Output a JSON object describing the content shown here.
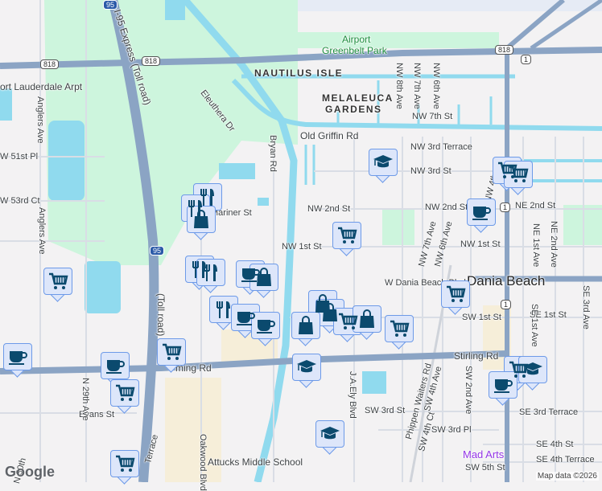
{
  "colors": {
    "land": "#f3f2f3",
    "park": "#cdf5dd",
    "water": "#90daee",
    "road": "#8ba4c4",
    "marker_bg": "#dde6fa",
    "marker_border": "#6d9ae8",
    "icon": "#0b4a6e"
  },
  "shields": {
    "sr818_a": "818",
    "sr818_b": "818",
    "sr818_c": "818",
    "i95_top": "95",
    "i95_mid": "95",
    "us1_a": "1",
    "us1_b": "1",
    "us1_c": "1"
  },
  "labels": [
    "Airport",
    "Greenbelt Park",
    "NAUTILUS ISLE",
    "MELALEUCA",
    "GARDENS",
    "NW 8th Ave",
    "NW 7th Ave",
    "NW 6th Ave",
    "NW 7th St",
    "Old Griffin Rd",
    "NW 3rd Terrace",
    "NW 3rd St",
    "NW 2nd St",
    "NW 2nd St",
    "NE 2nd St",
    "NW 1st St",
    "NW 1st St",
    "W Dania Beach Blvd",
    "Dania Beach",
    "SW 1st St",
    "SE 1st St",
    "Stirling Rd",
    "ming Rd",
    "SW 3rd St",
    "SW 3rd Pl",
    "SE 3rd Terrace",
    "SE 4th St",
    "SE 4th Terrace",
    "SW 5th St",
    "Mad Arts",
    "Attucks Middle School",
    "Evans St",
    "N 29th Ave",
    "Oakwood Blvd",
    "Bryan Rd",
    "Eleuthera Dr",
    "Mariner St",
    "Anglers Ave",
    "Anglers Ave",
    "W 51st Pl",
    "W 53rd Ct",
    "ort Lauderdale Arpt",
    "I-95 Express (Toll road)",
    "(Toll road)",
    "J.A.Ely Blvd",
    "Phippen Waiters Rd",
    "SW 4th Ave",
    "SW 4th Ct",
    "SW 2nd Ave",
    "NW 7th Ave",
    "NW 6th Ave",
    "NE 1st Ave",
    "SE 1st Ave",
    "NE 2nd Ave",
    "SE 3rd Ave",
    "NW 4th Ave",
    "N 30th",
    "Terrace"
  ],
  "markers": [
    "cart",
    "cart",
    "graduation-cap",
    "cart",
    "coffee",
    "cutlery",
    "cutlery",
    "shopping-bag",
    "cutlery",
    "cutlery",
    "coffee",
    "shopping-bag",
    "cutlery",
    "coffee",
    "coffee",
    "cart",
    "cart",
    "shopping-bag",
    "shopping-bag",
    "shopping-bag",
    "cart",
    "shopping-bag",
    "cart",
    "graduation-cap",
    "cart",
    "coffee",
    "coffee",
    "cart",
    "cart",
    "graduation-cap",
    "coffee",
    "graduation-cap",
    "cart"
  ],
  "attribution": "Map data ©2026",
  "logo": "Google"
}
